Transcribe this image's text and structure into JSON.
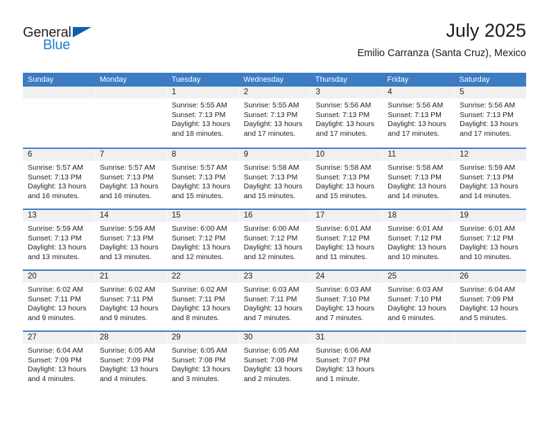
{
  "brand": {
    "name_part1": "General",
    "name_part2": "Blue",
    "triangle_color": "#0a62ae",
    "blue_text_color": "#1f7fd0"
  },
  "header": {
    "title": "July 2025",
    "subtitle": "Emilio Carranza (Santa Cruz), Mexico"
  },
  "colors": {
    "header_blue": "#3c7cc3",
    "date_band_gray": "#f0f0f0",
    "text": "#222222"
  },
  "weekdays": [
    "Sunday",
    "Monday",
    "Tuesday",
    "Wednesday",
    "Thursday",
    "Friday",
    "Saturday"
  ],
  "weeks": [
    [
      {
        "date": "",
        "sunrise": "",
        "sunset": "",
        "daylight_line1": "",
        "daylight_line2": ""
      },
      {
        "date": "",
        "sunrise": "",
        "sunset": "",
        "daylight_line1": "",
        "daylight_line2": ""
      },
      {
        "date": "1",
        "sunrise": "Sunrise: 5:55 AM",
        "sunset": "Sunset: 7:13 PM",
        "daylight_line1": "Daylight: 13 hours",
        "daylight_line2": "and 18 minutes."
      },
      {
        "date": "2",
        "sunrise": "Sunrise: 5:55 AM",
        "sunset": "Sunset: 7:13 PM",
        "daylight_line1": "Daylight: 13 hours",
        "daylight_line2": "and 17 minutes."
      },
      {
        "date": "3",
        "sunrise": "Sunrise: 5:56 AM",
        "sunset": "Sunset: 7:13 PM",
        "daylight_line1": "Daylight: 13 hours",
        "daylight_line2": "and 17 minutes."
      },
      {
        "date": "4",
        "sunrise": "Sunrise: 5:56 AM",
        "sunset": "Sunset: 7:13 PM",
        "daylight_line1": "Daylight: 13 hours",
        "daylight_line2": "and 17 minutes."
      },
      {
        "date": "5",
        "sunrise": "Sunrise: 5:56 AM",
        "sunset": "Sunset: 7:13 PM",
        "daylight_line1": "Daylight: 13 hours",
        "daylight_line2": "and 17 minutes."
      }
    ],
    [
      {
        "date": "6",
        "sunrise": "Sunrise: 5:57 AM",
        "sunset": "Sunset: 7:13 PM",
        "daylight_line1": "Daylight: 13 hours",
        "daylight_line2": "and 16 minutes."
      },
      {
        "date": "7",
        "sunrise": "Sunrise: 5:57 AM",
        "sunset": "Sunset: 7:13 PM",
        "daylight_line1": "Daylight: 13 hours",
        "daylight_line2": "and 16 minutes."
      },
      {
        "date": "8",
        "sunrise": "Sunrise: 5:57 AM",
        "sunset": "Sunset: 7:13 PM",
        "daylight_line1": "Daylight: 13 hours",
        "daylight_line2": "and 15 minutes."
      },
      {
        "date": "9",
        "sunrise": "Sunrise: 5:58 AM",
        "sunset": "Sunset: 7:13 PM",
        "daylight_line1": "Daylight: 13 hours",
        "daylight_line2": "and 15 minutes."
      },
      {
        "date": "10",
        "sunrise": "Sunrise: 5:58 AM",
        "sunset": "Sunset: 7:13 PM",
        "daylight_line1": "Daylight: 13 hours",
        "daylight_line2": "and 15 minutes."
      },
      {
        "date": "11",
        "sunrise": "Sunrise: 5:58 AM",
        "sunset": "Sunset: 7:13 PM",
        "daylight_line1": "Daylight: 13 hours",
        "daylight_line2": "and 14 minutes."
      },
      {
        "date": "12",
        "sunrise": "Sunrise: 5:59 AM",
        "sunset": "Sunset: 7:13 PM",
        "daylight_line1": "Daylight: 13 hours",
        "daylight_line2": "and 14 minutes."
      }
    ],
    [
      {
        "date": "13",
        "sunrise": "Sunrise: 5:59 AM",
        "sunset": "Sunset: 7:13 PM",
        "daylight_line1": "Daylight: 13 hours",
        "daylight_line2": "and 13 minutes."
      },
      {
        "date": "14",
        "sunrise": "Sunrise: 5:59 AM",
        "sunset": "Sunset: 7:13 PM",
        "daylight_line1": "Daylight: 13 hours",
        "daylight_line2": "and 13 minutes."
      },
      {
        "date": "15",
        "sunrise": "Sunrise: 6:00 AM",
        "sunset": "Sunset: 7:12 PM",
        "daylight_line1": "Daylight: 13 hours",
        "daylight_line2": "and 12 minutes."
      },
      {
        "date": "16",
        "sunrise": "Sunrise: 6:00 AM",
        "sunset": "Sunset: 7:12 PM",
        "daylight_line1": "Daylight: 13 hours",
        "daylight_line2": "and 12 minutes."
      },
      {
        "date": "17",
        "sunrise": "Sunrise: 6:01 AM",
        "sunset": "Sunset: 7:12 PM",
        "daylight_line1": "Daylight: 13 hours",
        "daylight_line2": "and 11 minutes."
      },
      {
        "date": "18",
        "sunrise": "Sunrise: 6:01 AM",
        "sunset": "Sunset: 7:12 PM",
        "daylight_line1": "Daylight: 13 hours",
        "daylight_line2": "and 10 minutes."
      },
      {
        "date": "19",
        "sunrise": "Sunrise: 6:01 AM",
        "sunset": "Sunset: 7:12 PM",
        "daylight_line1": "Daylight: 13 hours",
        "daylight_line2": "and 10 minutes."
      }
    ],
    [
      {
        "date": "20",
        "sunrise": "Sunrise: 6:02 AM",
        "sunset": "Sunset: 7:11 PM",
        "daylight_line1": "Daylight: 13 hours",
        "daylight_line2": "and 9 minutes."
      },
      {
        "date": "21",
        "sunrise": "Sunrise: 6:02 AM",
        "sunset": "Sunset: 7:11 PM",
        "daylight_line1": "Daylight: 13 hours",
        "daylight_line2": "and 9 minutes."
      },
      {
        "date": "22",
        "sunrise": "Sunrise: 6:02 AM",
        "sunset": "Sunset: 7:11 PM",
        "daylight_line1": "Daylight: 13 hours",
        "daylight_line2": "and 8 minutes."
      },
      {
        "date": "23",
        "sunrise": "Sunrise: 6:03 AM",
        "sunset": "Sunset: 7:11 PM",
        "daylight_line1": "Daylight: 13 hours",
        "daylight_line2": "and 7 minutes."
      },
      {
        "date": "24",
        "sunrise": "Sunrise: 6:03 AM",
        "sunset": "Sunset: 7:10 PM",
        "daylight_line1": "Daylight: 13 hours",
        "daylight_line2": "and 7 minutes."
      },
      {
        "date": "25",
        "sunrise": "Sunrise: 6:03 AM",
        "sunset": "Sunset: 7:10 PM",
        "daylight_line1": "Daylight: 13 hours",
        "daylight_line2": "and 6 minutes."
      },
      {
        "date": "26",
        "sunrise": "Sunrise: 6:04 AM",
        "sunset": "Sunset: 7:09 PM",
        "daylight_line1": "Daylight: 13 hours",
        "daylight_line2": "and 5 minutes."
      }
    ],
    [
      {
        "date": "27",
        "sunrise": "Sunrise: 6:04 AM",
        "sunset": "Sunset: 7:09 PM",
        "daylight_line1": "Daylight: 13 hours",
        "daylight_line2": "and 4 minutes."
      },
      {
        "date": "28",
        "sunrise": "Sunrise: 6:05 AM",
        "sunset": "Sunset: 7:09 PM",
        "daylight_line1": "Daylight: 13 hours",
        "daylight_line2": "and 4 minutes."
      },
      {
        "date": "29",
        "sunrise": "Sunrise: 6:05 AM",
        "sunset": "Sunset: 7:08 PM",
        "daylight_line1": "Daylight: 13 hours",
        "daylight_line2": "and 3 minutes."
      },
      {
        "date": "30",
        "sunrise": "Sunrise: 6:05 AM",
        "sunset": "Sunset: 7:08 PM",
        "daylight_line1": "Daylight: 13 hours",
        "daylight_line2": "and 2 minutes."
      },
      {
        "date": "31",
        "sunrise": "Sunrise: 6:06 AM",
        "sunset": "Sunset: 7:07 PM",
        "daylight_line1": "Daylight: 13 hours",
        "daylight_line2": "and 1 minute."
      },
      {
        "date": "",
        "sunrise": "",
        "sunset": "",
        "daylight_line1": "",
        "daylight_line2": ""
      },
      {
        "date": "",
        "sunrise": "",
        "sunset": "",
        "daylight_line1": "",
        "daylight_line2": ""
      }
    ]
  ]
}
